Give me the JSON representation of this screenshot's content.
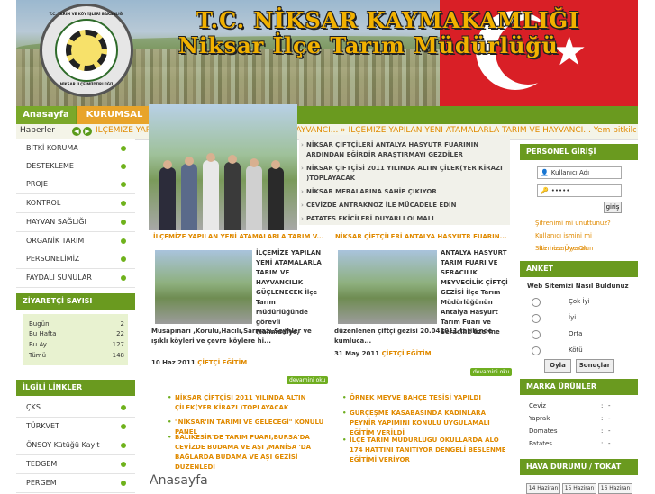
{
  "header": {
    "title_line1": "T.C. NİKSAR KAYMAKAMLIĞI",
    "title_line2": "Niksar İlçe Tarım Müdürlüğü",
    "logo_text_top": "T.C. TARIM VE KÖY İŞLERİ BAKANLIĞI",
    "logo_text_bottom": "NİKSAR İLÇE MÜDÜRLÜĞÜ"
  },
  "nav": {
    "home": "Anasayfa",
    "kurumsal": "KURUMSAL"
  },
  "ticker": {
    "label": "Haberler",
    "text": "İLÇEMİZE YAPILAN YENİ ATAMALARLA TARIM VE HAYVANCI... » İLÇEMİZE YAPILAN YENİ ATAMALARLA TARIM VE HAYVANCI... Yem bitkileri köylere"
  },
  "sidebar": {
    "menu": [
      "BİTKİ KORUMA",
      "DESTEKLEME",
      "PROJE",
      "KONTROL",
      "HAYVAN SAĞLIĞI",
      "ORGANİK TARIM",
      "PERSONELİMİZ",
      "FAYDALI SUNULAR"
    ],
    "visitors_title": "ZİYARETÇİ SAYISI",
    "visitors": [
      {
        "label": "Bugün",
        "value": "2"
      },
      {
        "label": "Bu Hafta",
        "value": "22"
      },
      {
        "label": "Bu Ay",
        "value": "127"
      },
      {
        "label": "Tümü",
        "value": "148"
      }
    ],
    "links_title": "İLGİLİ LİNKLER",
    "links": [
      "ÇKS",
      "TÜRKVET",
      "ÖNSOY Kütüğü Kayıt",
      "TEDGEM",
      "PERGEM"
    ]
  },
  "slideshow": {
    "items": [
      "NİKSAR ÇİFTÇİLERİ ANTALYA HASYUTR FUARININ ARDINDAN EĞİRDİR ARAŞTIRMAYI GEZDİLER",
      "NİKSAR ÇİFTÇİSİ 2011 YILINDA ALTIN ÇİLEK(YER KİRAZI )TOPLAYACAK",
      "NİKSAR MERALARINA SAHİP ÇIKIYOR",
      "CEVİZDE ANTRAKNOZ İLE MÜCADELE EDİN",
      "PATATES EKİCİLERİ DUYARLI OLMALI"
    ]
  },
  "articles": [
    {
      "title": "İLÇEMİZE YAPILAN YENİ ATAMALARLA TARIM V...",
      "body_right": "İLÇEMİZE YAPILAN YENİ ATAMALARLA TARIM VE HAYVANCILIK GÜÇLENECEK İlçe Tarım müdürlüğünde görevli Mahmudiye,",
      "body_bottom": "Musapınarı ,Korulu,Hacılı,Sarıyazı,Seyhler ve ışıklı köyleri ve çevre köylere hi...",
      "date": "10 Haz 2011",
      "category": "ÇİFTÇİ EĞİTİM",
      "more": "devamini oku"
    },
    {
      "title": "NİKSAR ÇİFTÇİLERİ ANTALYA HASYUTR FUARIN...",
      "body_right": "ANTALYA HASYURT TARIM FUARI VE SERACILIK MEYVECİLİK ÇİFTÇİ GEZİSİ  İlçe Tarım Müdürlüğünün Antalya Hasyurt Tarım Fuarı ve Seracılık üzerine",
      "body_bottom": "düzenlenen çiftçi gezisi 20.042011 tarihinde kumluca...",
      "date": "31 May 2011",
      "category": "ÇİFTÇİ EĞİTİM",
      "more": "devamini oku"
    }
  ],
  "bullets_left": [
    "NİKSAR ÇİFTÇİSİ 2011 YILINDA ALTIN ÇİLEK(YER KİRAZI )TOPLAYACAK",
    "\"NİKSAR'IN TARIMI VE GELECEĞİ\" KONULU PANEL",
    "BALIKESİR'DE TARIM FUARI,BURSA'DA CEVİZDE BUDAMA VE AŞI ,MANİSA 'DA BAĞLARDA BUDAMA VE AŞI GEZİSİ DÜZENLEDİ"
  ],
  "bullets_right": [
    "ÖRNEK MEYVE BAHÇE TESİSİ YAPILDI",
    "GÜRÇEŞME KASABASINDA KADINLARA PEYNİR YAPIMINI KONULU UYGULAMALI EĞİTİM VERİLDİ",
    "İLÇE TARIM MÜDÜRLÜĞÜ OKULLARDA ALO 174 HATTINI TANITIYOR DENGELİ BESLENME EĞİTİMİ VERİYOR"
  ],
  "main_heading": "Anasayfa",
  "login": {
    "title": "PERSONEL GİRİŞİ",
    "username_placeholder": "Kullanıcı Adı",
    "password_value": "•••••",
    "submit": "giriş",
    "forgot_password": "Şifrenimi mi unuttunuz?",
    "forgot_username": "Kullanıcı ismini mi",
    "register": "Sitemize Üye Olun",
    "register_overlap": "Bir hesap yarat"
  },
  "poll": {
    "title": "ANKET",
    "question": "Web Sitemizi Nasıl Buldunuz",
    "options": [
      "Çok İyi",
      "İyi",
      "Orta",
      "Kötü"
    ],
    "vote": "Oyla",
    "results": "Sonuçlar"
  },
  "products": {
    "title": "MARKA ÜRÜNLER",
    "rows": [
      {
        "name": "Ceviz",
        "sep": ":",
        "val": "-"
      },
      {
        "name": "Yaprak",
        "sep": ":",
        "val": "-"
      },
      {
        "name": "Domates",
        "sep": ":",
        "val": "-"
      },
      {
        "name": "Patates",
        "sep": ":",
        "val": "-"
      }
    ]
  },
  "weather": {
    "title": "HAVA DURUMU / TOKAT",
    "tabs": [
      "14 Haziran",
      "15 Haziran",
      "16 Haziran"
    ]
  },
  "colors": {
    "nav_green": "#6a9a1f",
    "accent_orange": "#e08a00",
    "kurumsal_tab": "#e8a42a"
  }
}
